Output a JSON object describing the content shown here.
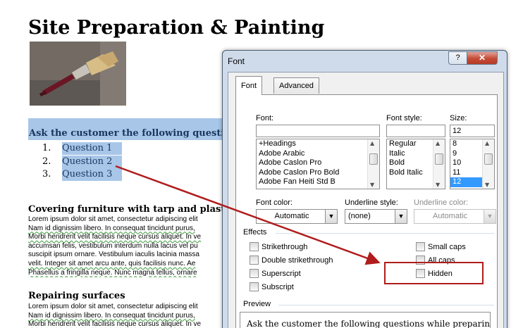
{
  "document": {
    "title": "Site Preparation & Painting",
    "ask_line": "Ask the customer the following question",
    "questions": [
      {
        "num": "1.",
        "text": "Question 1"
      },
      {
        "num": "2.",
        "text": "Question 2"
      },
      {
        "num": "3.",
        "text": "Question 3"
      }
    ],
    "section1_heading": "Covering furniture with tarp and plastic",
    "section1_lines": [
      "Lorem ipsum dolor sit amet, consectetur adipiscing elit",
      "Nam id dignissim libero. In consequat tincidunt purus,",
      "Morbi hendrerit velit facilisis neque cursus aliquet. In ve",
      "accumsan felis, vestibulum interdum nulla lacus vel pu",
      "suscipit ipsum ornare. Vestibulum iaculis lacinia massa",
      "velit. Integer sit amet arcu ante, quis facilisis nunc. Ae",
      "Phasellus a fringilla neque. Nunc magna tellus, ornare"
    ],
    "section2_heading": "Repairing surfaces",
    "section2_lines": [
      "Lorem ipsum dolor sit amet, consectetur adipiscing elit",
      "Nam id dignissim libero. In consequat tincidunt purus,",
      "Morbi hendrerit velit facilisis neque cursus aliquet. In ve"
    ]
  },
  "dialog": {
    "title": "Font",
    "help_label": "?",
    "close_label": "✕",
    "tabs": [
      {
        "label": "Font",
        "active": true
      },
      {
        "label": "Advanced",
        "active": false
      }
    ],
    "font_label": "Font:",
    "font_value": "",
    "font_list": [
      "+Headings",
      "Adobe Arabic",
      "Adobe Caslon Pro",
      "Adobe Caslon Pro Bold",
      "Adobe Fan Heiti Std B"
    ],
    "style_label": "Font style:",
    "style_value": "",
    "style_list": [
      "Regular",
      "Italic",
      "Bold",
      "Bold Italic"
    ],
    "size_label": "Size:",
    "size_value": "12",
    "size_list": [
      "8",
      "9",
      "10",
      "11",
      "12"
    ],
    "size_selected": "12",
    "font_color_label": "Font color:",
    "font_color_value": "Automatic",
    "underline_style_label": "Underline style:",
    "underline_style_value": "(none)",
    "underline_color_label": "Underline color:",
    "underline_color_value": "Automatic",
    "effects_label": "Effects",
    "effects_left": [
      "Strikethrough",
      "Double strikethrough",
      "Superscript",
      "Subscript"
    ],
    "effects_right": [
      "Small caps",
      "All caps",
      "Hidden"
    ],
    "preview_label": "Preview",
    "preview_text": "Ask the customer the following questions while preparing"
  },
  "colors": {
    "highlight_box": "#b01c1c",
    "arrow": "#b01c1c",
    "selection": "#a8c6e8"
  }
}
